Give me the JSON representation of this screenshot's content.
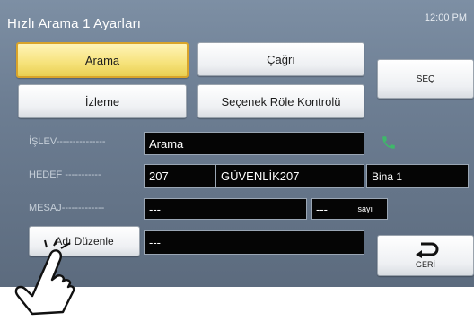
{
  "header": {
    "title": "Hızlı Arama 1 Ayarları",
    "time": "12:00 PM"
  },
  "buttons": {
    "arama": "Arama",
    "cagri": "Çağrı",
    "izleme": "İzleme",
    "secenek": "Seçenek Röle Kontrolü",
    "sec": "SEÇ",
    "adi_duzenle": "Adı Düzenle",
    "geri": "GERİ"
  },
  "fields": {
    "islev_label": "İŞLEV",
    "islev_value": "Arama",
    "hedef_label": "HEDEF",
    "hedef_number": "207",
    "hedef_name": "GÜVENLİK207",
    "hedef_bina": "Bina 1",
    "mesaj_label": "MESAJ",
    "mesaj_value": "---",
    "mesaj_count": "---",
    "mesaj_unit": "sayı",
    "name_value": "---"
  },
  "icons": {
    "phone": "phone-icon",
    "back": "back-arrow-icon",
    "hand": "tap-hand-icon"
  },
  "colors": {
    "active_button": "#f6e27a",
    "active_border": "#d9a42a",
    "phone": "#3fb86a",
    "background": "#6d7e93"
  }
}
